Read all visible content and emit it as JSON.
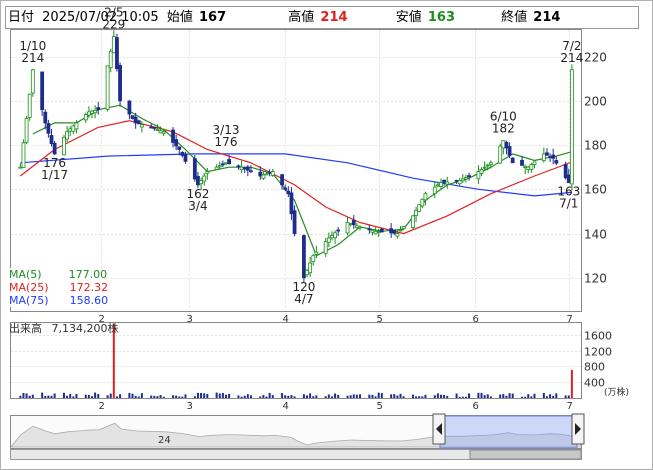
{
  "header": {
    "date_label": "日付",
    "datetime": "2025/07/02 10:05",
    "open_label": "始値",
    "open": "167",
    "high_label": "高値",
    "high": "214",
    "low_label": "安値",
    "low": "163",
    "close_label": "終値",
    "close": "214"
  },
  "colors": {
    "up": "#1a8f1a",
    "down": "#1e2c8c",
    "high": "#e02020",
    "ma5": "#228b22",
    "ma25": "#e02020",
    "ma75": "#1e3cff",
    "volume": "#1e2c8c",
    "volume_spike": "#e02020"
  },
  "ma_legend": [
    {
      "label": "MA(5)",
      "value": "177.00"
    },
    {
      "label": "MA(25)",
      "value": "172.32"
    },
    {
      "label": "MA(75)",
      "value": "158.60"
    }
  ],
  "volume_panel": {
    "title": "出来高",
    "value": "7,134,200株",
    "unit": "(万株)",
    "y_ticks": [
      "1600",
      "1200",
      "800",
      "400"
    ]
  },
  "navigator": {
    "label": "24",
    "left_handle_icon": "triangle-left-icon",
    "right_handle_icon": "triangle-right-icon"
  },
  "chart_data": {
    "type": "candlestick",
    "x_months": [
      "2",
      "3",
      "4",
      "5",
      "6",
      "7"
    ],
    "x_month_dates": [
      "2025-02-01",
      "2025-03-01",
      "2025-04-01",
      "2025-05-01",
      "2025-06-01",
      "2025-07-01"
    ],
    "y_ticks": [
      120,
      140,
      160,
      180,
      200,
      220
    ],
    "ylim": [
      105,
      232
    ],
    "price_series": [
      [
        "2025-01-06",
        170
      ],
      [
        "2025-01-10",
        214
      ],
      [
        "2025-01-14",
        190
      ],
      [
        "2025-01-17",
        176
      ],
      [
        "2025-01-21",
        186
      ],
      [
        "2025-01-24",
        190
      ],
      [
        "2025-01-28",
        195
      ],
      [
        "2025-01-31",
        196
      ],
      [
        "2025-02-05",
        229
      ],
      [
        "2025-02-07",
        200
      ],
      [
        "2025-02-12",
        190
      ],
      [
        "2025-02-17",
        188
      ],
      [
        "2025-02-21",
        186
      ],
      [
        "2025-02-26",
        178
      ],
      [
        "2025-03-04",
        162
      ],
      [
        "2025-03-07",
        168
      ],
      [
        "2025-03-13",
        172
      ],
      [
        "2025-03-18",
        170
      ],
      [
        "2025-03-24",
        166
      ],
      [
        "2025-03-28",
        168
      ],
      [
        "2025-04-02",
        158
      ],
      [
        "2025-04-04",
        140
      ],
      [
        "2025-04-07",
        120
      ],
      [
        "2025-04-10",
        130
      ],
      [
        "2025-04-15",
        138
      ],
      [
        "2025-04-21",
        145
      ],
      [
        "2025-04-25",
        143
      ],
      [
        "2025-04-30",
        141
      ],
      [
        "2025-05-07",
        140
      ],
      [
        "2025-05-12",
        148
      ],
      [
        "2025-05-16",
        158
      ],
      [
        "2025-05-21",
        163
      ],
      [
        "2025-05-27",
        164
      ],
      [
        "2025-06-02",
        168
      ],
      [
        "2025-06-06",
        172
      ],
      [
        "2025-06-10",
        182
      ],
      [
        "2025-06-13",
        172
      ],
      [
        "2025-06-18",
        170
      ],
      [
        "2025-06-23",
        176
      ],
      [
        "2025-06-26",
        174
      ],
      [
        "2025-07-01",
        163
      ],
      [
        "2025-07-02",
        214
      ]
    ],
    "ma5": [
      [
        "2025-01-10",
        185
      ],
      [
        "2025-01-17",
        190
      ],
      [
        "2025-01-24",
        190
      ],
      [
        "2025-01-31",
        196
      ],
      [
        "2025-02-07",
        198
      ],
      [
        "2025-02-14",
        192
      ],
      [
        "2025-02-21",
        187
      ],
      [
        "2025-02-28",
        178
      ],
      [
        "2025-03-07",
        168
      ],
      [
        "2025-03-14",
        170
      ],
      [
        "2025-03-21",
        170
      ],
      [
        "2025-03-28",
        167
      ],
      [
        "2025-04-04",
        155
      ],
      [
        "2025-04-11",
        130
      ],
      [
        "2025-04-18",
        135
      ],
      [
        "2025-04-25",
        143
      ],
      [
        "2025-05-02",
        141
      ],
      [
        "2025-05-09",
        142
      ],
      [
        "2025-05-16",
        155
      ],
      [
        "2025-05-23",
        162
      ],
      [
        "2025-05-30",
        165
      ],
      [
        "2025-06-06",
        170
      ],
      [
        "2025-06-13",
        176
      ],
      [
        "2025-06-20",
        173
      ],
      [
        "2025-06-27",
        175
      ],
      [
        "2025-07-02",
        177
      ]
    ],
    "ma25": [
      [
        "2025-01-06",
        166
      ],
      [
        "2025-01-17",
        178
      ],
      [
        "2025-01-31",
        188
      ],
      [
        "2025-02-10",
        191
      ],
      [
        "2025-02-24",
        186
      ],
      [
        "2025-03-07",
        178
      ],
      [
        "2025-03-21",
        172
      ],
      [
        "2025-04-04",
        162
      ],
      [
        "2025-04-14",
        152
      ],
      [
        "2025-04-25",
        145
      ],
      [
        "2025-05-09",
        140
      ],
      [
        "2025-05-23",
        148
      ],
      [
        "2025-06-06",
        158
      ],
      [
        "2025-06-20",
        166
      ],
      [
        "2025-07-02",
        172.32
      ]
    ],
    "ma75": [
      [
        "2025-01-06",
        172
      ],
      [
        "2025-02-03",
        175
      ],
      [
        "2025-03-03",
        176
      ],
      [
        "2025-04-01",
        176
      ],
      [
        "2025-04-21",
        172
      ],
      [
        "2025-05-12",
        165
      ],
      [
        "2025-06-02",
        160
      ],
      [
        "2025-06-20",
        157
      ],
      [
        "2025-07-02",
        158.6
      ]
    ],
    "volume_ticks": [
      400,
      800,
      1200,
      1600
    ],
    "volume_ylim": [
      0,
      1900
    ],
    "volume_spikes": [
      [
        "2025-02-05",
        1880
      ],
      [
        "2025-07-02",
        713
      ]
    ],
    "annotations": [
      {
        "date": "2025-01-10",
        "value": 214,
        "text_top": "1/10",
        "text_bottom": "214",
        "pos": "above"
      },
      {
        "date": "2025-02-05",
        "value": 229,
        "text_top": "2/5",
        "text_bottom": "229",
        "pos": "above"
      },
      {
        "date": "2025-01-17",
        "value": 176,
        "text_top": "176",
        "text_bottom": "1/17",
        "pos": "below"
      },
      {
        "date": "2025-03-13",
        "value": 176,
        "text_top": "3/13",
        "text_bottom": "176",
        "pos": "above"
      },
      {
        "date": "2025-03-04",
        "value": 162,
        "text_top": "162",
        "text_bottom": "3/4",
        "pos": "below"
      },
      {
        "date": "2025-04-07",
        "value": 120,
        "text_top": "120",
        "text_bottom": "4/7",
        "pos": "below"
      },
      {
        "date": "2025-06-10",
        "value": 182,
        "text_top": "6/10",
        "text_bottom": "182",
        "pos": "above"
      },
      {
        "date": "2025-07-02",
        "value": 214,
        "text_top": "7/2",
        "text_bottom": "214",
        "pos": "above"
      },
      {
        "date": "2025-07-01",
        "value": 163,
        "text_top": "163",
        "text_bottom": "7/1",
        "pos": "below"
      }
    ]
  }
}
